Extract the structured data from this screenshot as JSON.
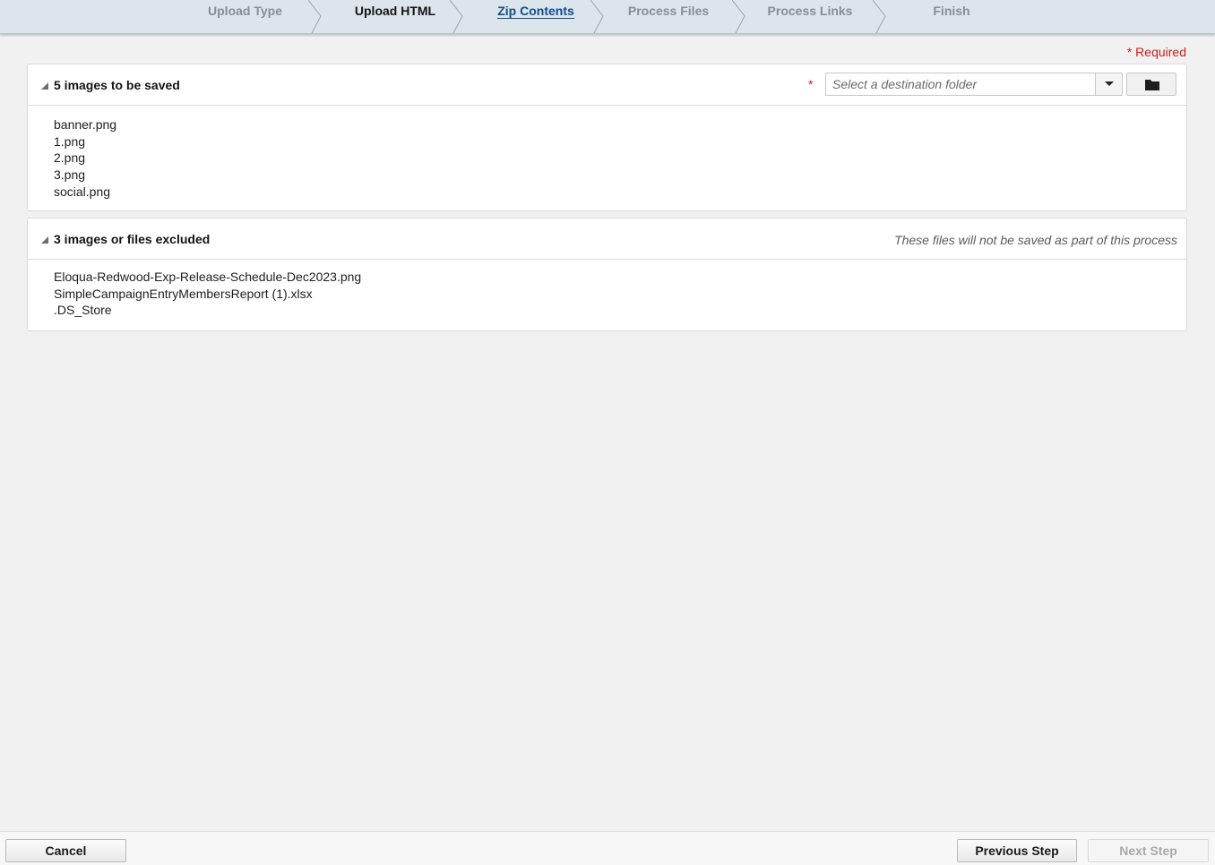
{
  "wizard": {
    "steps": [
      {
        "label": "Upload Type",
        "state": "completed"
      },
      {
        "label": "Upload HTML",
        "state": "completed"
      },
      {
        "label": "Zip Contents",
        "state": "active"
      },
      {
        "label": "Process Files",
        "state": "pending"
      },
      {
        "label": "Process Links",
        "state": "pending"
      },
      {
        "label": "Finish",
        "state": "pending"
      }
    ]
  },
  "required_note": "* Required",
  "saved_panel": {
    "title": "5 images to be saved",
    "required_star": "*",
    "folder_placeholder": "Select a destination folder",
    "files": [
      "banner.png",
      "1.png",
      "2.png",
      "3.png",
      "social.png"
    ]
  },
  "excluded_panel": {
    "title": "3 images or files excluded",
    "note": "These files will not be saved as part of this process",
    "files": [
      "Eloqua-Redwood-Exp-Release-Schedule-Dec2023.png",
      "SimpleCampaignEntryMembersReport (1).xlsx",
      ".DS_Store"
    ]
  },
  "footer": {
    "cancel_label": "Cancel",
    "previous_label": "Previous Step",
    "next_label": "Next Step"
  },
  "colors": {
    "stepbar_bg": "#dce4ec",
    "active_step": "#0f4f8c",
    "required_red": "#d11b1b"
  }
}
